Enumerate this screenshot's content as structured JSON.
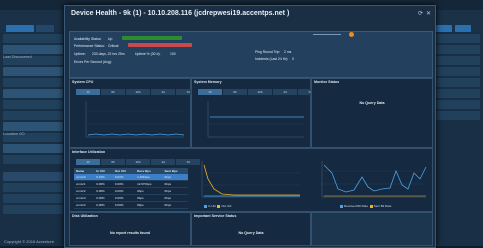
{
  "background": {
    "left_items": [
      "Last Discovered",
      "Location 0O"
    ],
    "bottom_tabs": [
      "Sort",
      "Details",
      "Event"
    ],
    "copyright": "Copyright © 2016 Accenture"
  },
  "modal": {
    "title": "Device Health - 9k (1) - 10.10.208.116 (jcdrepwesi19.accentps.net )",
    "status": {
      "availability_label": "Availability Status:",
      "availability_value": "Up",
      "performance_label": "Performance Status:",
      "performance_value": "Critical",
      "uptime_label": "Uptime:",
      "uptime_value": "233 days, 22 hrs 25m",
      "uptime_pct_label": "Uptime % (30 d):",
      "uptime_pct_value": "100",
      "errors_label": "Errors Per Second (Avg):",
      "errors_value": "",
      "ping_label": "Ping Round Trip:",
      "ping_value": "2 ms",
      "incidents_label": "Incidents (Last 24 Hr):",
      "incidents_value": "0"
    },
    "cpu": {
      "title": "System CPU",
      "tabs": [
        "1h",
        "6h",
        "12h",
        "1d",
        "7d"
      ]
    },
    "memory": {
      "title": "System Memory",
      "tabs": [
        "1h",
        "6h",
        "12h",
        "1d",
        "7d"
      ]
    },
    "monitor": {
      "title": "Monitor Status",
      "message": "No Query Data"
    },
    "interface": {
      "title": "Interface Utilization",
      "tabs": [
        "1h",
        "6h",
        "12h",
        "1d",
        "7d"
      ],
      "columns": [
        "Name",
        "In Util",
        "Out Util",
        "Recv Bps",
        "Sent Bps"
      ],
      "rows": [
        [
          "vmnic0",
          "0.16%",
          "0.01%",
          "1.46Kbps",
          "0bps"
        ],
        [
          "vmnic1",
          "0.00%",
          "0.00%",
          "12.67Kbps",
          "0bps"
        ],
        [
          "vmnic2",
          "0.00%",
          "0.00%",
          "0bps",
          "0bps"
        ],
        [
          "vmnic3",
          "0.00%",
          "0.00%",
          "0bps",
          "0bps"
        ],
        [
          "vmnic4",
          "0.00%",
          "0.00%",
          "0bps",
          "0bps"
        ]
      ],
      "legend": [
        "In Util",
        "Out Util"
      ],
      "rate_legend": [
        "Received Bit Rate",
        "Sent Bit Rate"
      ]
    },
    "disk": {
      "title": "Disk Utilization",
      "message": "No report results found"
    },
    "services": {
      "title": "Important Service Status",
      "message": "No Query Data"
    }
  },
  "colors": {
    "up": "#2e8b2e",
    "critical": "#c94a4a",
    "accent": "#f08a24",
    "line": "#4aa3e8"
  }
}
